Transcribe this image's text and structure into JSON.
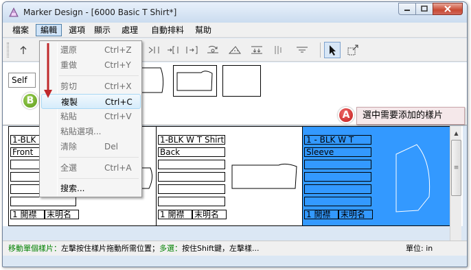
{
  "window": {
    "title": "Marker Design - [6000 Basic T Shirt*]",
    "colors": {
      "close_button": "#c84a33",
      "selection": "#3399ff"
    }
  },
  "menubar": {
    "items": [
      "檔案",
      "編輯",
      "選項",
      "顯示",
      "處理",
      "自動排料",
      "幫助"
    ],
    "active": "編輯"
  },
  "toolbar": {
    "icons": [
      "arrow-up-icon",
      "align-piece-icon",
      "bracket-left-icon",
      "bracket-right-icon",
      "rotate-icon",
      "flip-icon",
      "spread-icon",
      "bars-icon",
      "lines-icon",
      "pointer-icon",
      "zoom-window-icon"
    ],
    "pressed": "pointer-icon"
  },
  "upper": {
    "self_combo": "Self"
  },
  "dropdown": {
    "items": [
      {
        "label": "還原",
        "shortcut": "Ctrl+Z",
        "enabled": false
      },
      {
        "label": "重做",
        "shortcut": "Ctrl+Y",
        "enabled": false
      },
      {
        "label": "剪切",
        "shortcut": "Ctrl+X",
        "enabled": false
      },
      {
        "label": "複製",
        "shortcut": "Ctrl+C",
        "enabled": true,
        "highlighted": true
      },
      {
        "label": "粘貼",
        "shortcut": "Ctrl+V",
        "enabled": false
      },
      {
        "label": "粘貼選項...",
        "shortcut": "",
        "enabled": false
      },
      {
        "label": "清除",
        "shortcut": "Del",
        "enabled": false
      },
      {
        "label": "全選",
        "shortcut": "Ctrl+A",
        "enabled": false
      },
      {
        "label": "搜索...",
        "shortcut": "",
        "enabled": true
      }
    ]
  },
  "pieces": [
    {
      "line1": "1-BLK",
      "line2": "Front",
      "footer_a": "1 開襟",
      "footer_b": "末明名",
      "selected": false
    },
    {
      "line1": "1-BLK W T Shirt",
      "line2": "Back",
      "footer_a": "1 開襟",
      "footer_b": "末明名",
      "selected": false
    },
    {
      "line1": "1 - BLK W T",
      "line2": "Sleeve",
      "footer_a": "1 開襟",
      "footer_b": "末明名",
      "selected": true
    }
  ],
  "annotations": {
    "badge_a": "A",
    "badge_b": "B",
    "callout_a": "選中需要添加的樣片"
  },
  "statusbar": {
    "green1": "移動單個樣片：",
    "text1": "左擊按住樣片拖動所需位置；",
    "green2": "多選：",
    "text2": "按住Shift鍵，左擊樣...",
    "unit": "單位: in"
  }
}
